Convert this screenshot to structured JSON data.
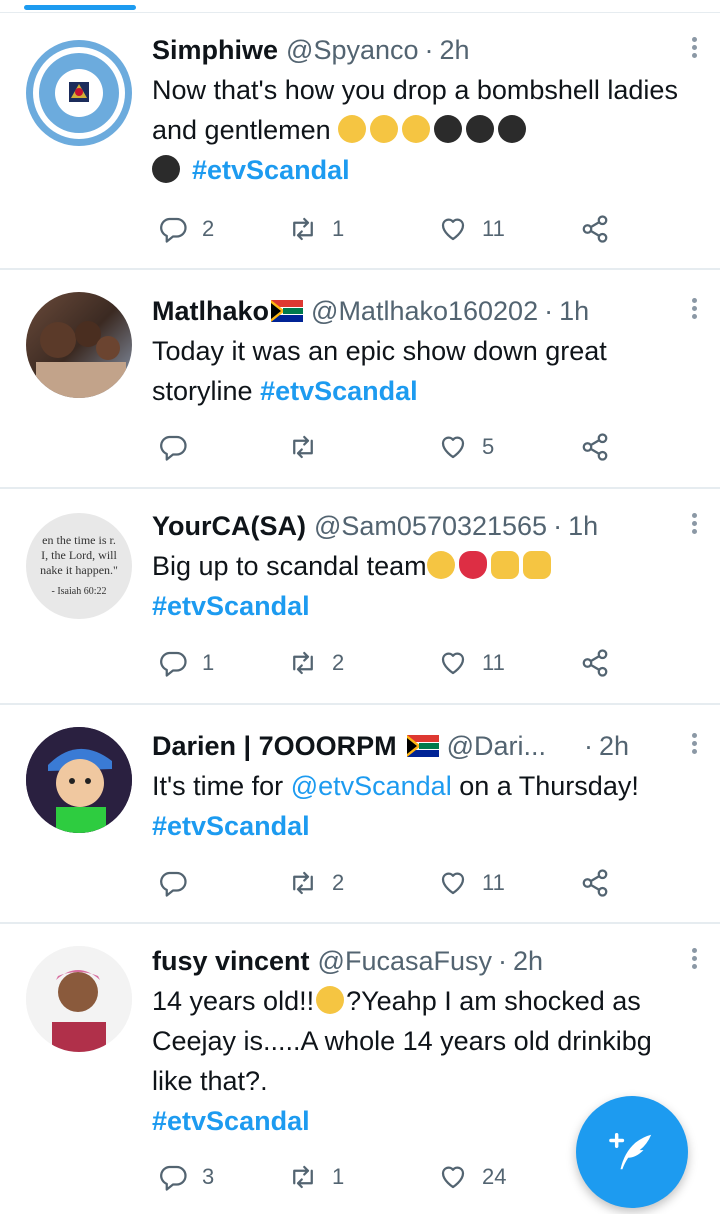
{
  "tweets": [
    {
      "name": "Simphiwe",
      "handle": "@Spyanco",
      "time": "2h",
      "text_a": "Now that's how you drop a bombshell ladies and gentlemen",
      "hashtag": "#etvScandal",
      "emojis": [
        "ok-hand",
        "ok-hand",
        "ok-hand",
        "bomb",
        "bomb",
        "bomb",
        "bomb"
      ],
      "replies": "2",
      "retweets": "1",
      "likes": "11"
    },
    {
      "name": "Matlhako",
      "handle": "@Matlhako160202",
      "time": "1h",
      "text_a": "Today it was an epic show down great storyline",
      "hashtag": "#etvScandal",
      "replies": "",
      "retweets": "",
      "likes": "5"
    },
    {
      "name": "YourCA(SA)",
      "handle": "@Sam0570321565",
      "time": "1h",
      "text_a": "Big up to scandal team",
      "hashtag": "#etvScandal",
      "emojis": [
        "crying-face",
        "red-heart",
        "folded-hands",
        "clapping-hands"
      ],
      "avatar_quote": [
        "en the time is r.",
        "I, the Lord, will",
        "nake it happen.\"",
        "- Isaiah 60:22"
      ],
      "replies": "1",
      "retweets": "2",
      "likes": "11"
    },
    {
      "name": "Darien | 7OOORPM",
      "handle": "@Dari...",
      "time": "2h",
      "text_a": "It's time for",
      "mention": "@etvScandal",
      "text_b": "on a Thursday!",
      "hashtag": "#etvScandal",
      "replies": "",
      "retweets": "2",
      "likes": "11"
    },
    {
      "name": "fusy vincent",
      "handle": "@FucasaFusy",
      "time": "2h",
      "text_a": "14 years old!!",
      "text_b": "?Yeahp I am shocked as Ceejay is.....A whole 14 years old drinkibg like that?.",
      "hashtag": "#etvScandal",
      "emojis": [
        "hushed-face"
      ],
      "replies": "3",
      "retweets": "1",
      "likes": "24"
    }
  ],
  "separator": "·",
  "colors": {
    "accent": "#1d9bf0",
    "muted": "#536471",
    "border": "#e6ecf0"
  },
  "icons": {
    "reply": "reply-icon",
    "retweet": "retweet-icon",
    "like": "heart-icon",
    "share": "share-icon",
    "compose": "compose-tweet-icon"
  }
}
